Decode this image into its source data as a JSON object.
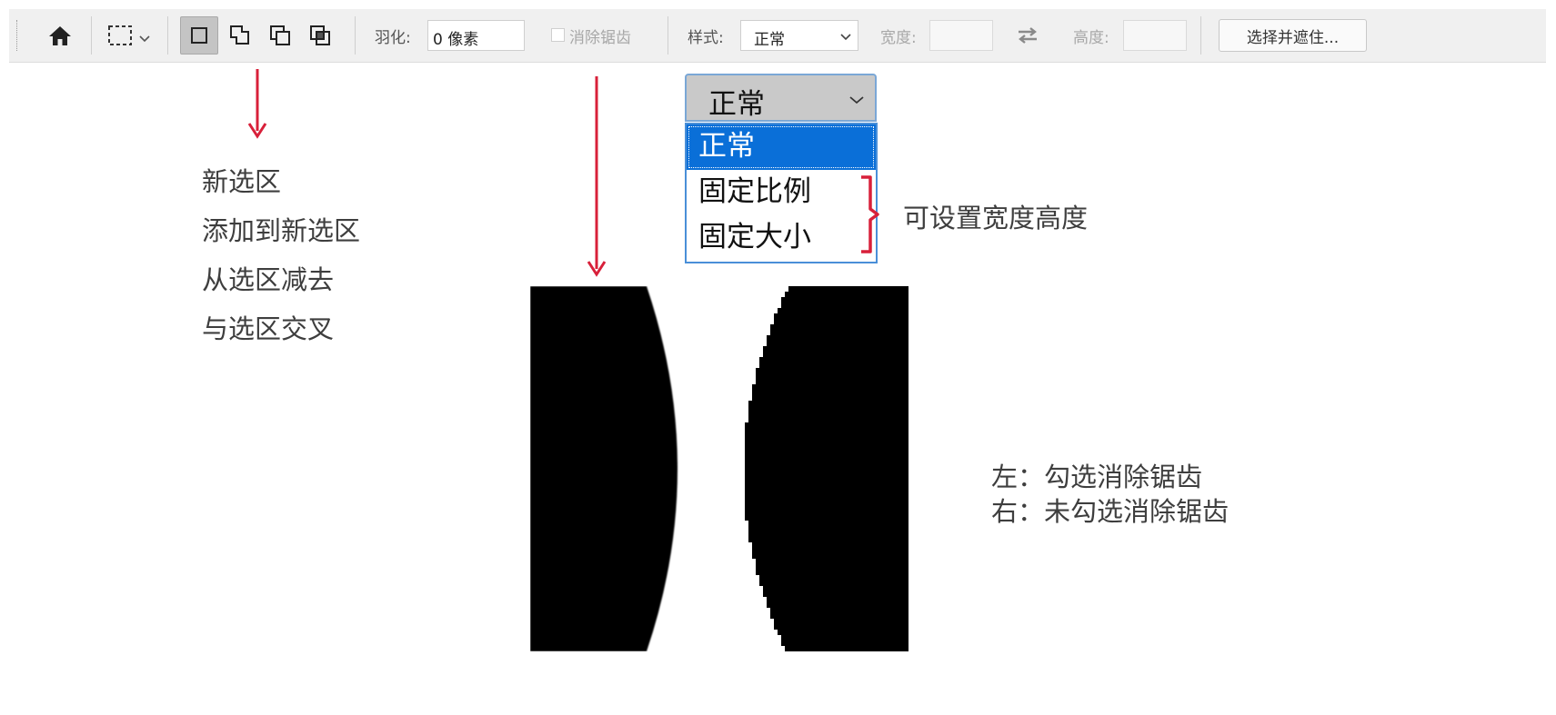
{
  "options_bar": {
    "home_icon": "home-icon",
    "marquee_tool_icon": "rect-marquee-icon",
    "selection_modes": [
      {
        "icon": "new-selection-icon",
        "active": true
      },
      {
        "icon": "add-to-selection-icon",
        "active": false
      },
      {
        "icon": "subtract-from-selection-icon",
        "active": false
      },
      {
        "icon": "intersect-selection-icon",
        "active": false
      }
    ],
    "feather_label": "羽化:",
    "feather_value": "0 像素",
    "antialias_label": "消除锯齿",
    "style_label": "样式:",
    "style_value": "正常",
    "width_label": "宽度:",
    "width_value": "",
    "swap_icon": "swap-arrows-icon",
    "height_label": "高度:",
    "height_value": "",
    "select_mask_button": "选择并遮住..."
  },
  "mode_annotations": [
    "新选区",
    "添加到新选区",
    "从选区减去",
    "与选区交叉"
  ],
  "style_dropdown": {
    "selected": "正常",
    "options": [
      "正常",
      "固定比例",
      "固定大小"
    ],
    "note": "可设置宽度高度"
  },
  "antialias_compare": {
    "line1": "左：勾选消除锯齿",
    "line2": "右：未勾选消除锯齿"
  },
  "colors": {
    "accent_arrow": "#d8203a",
    "dropdown_highlight": "#0a6fd8",
    "toolbar_bg": "#f0f0f0"
  }
}
